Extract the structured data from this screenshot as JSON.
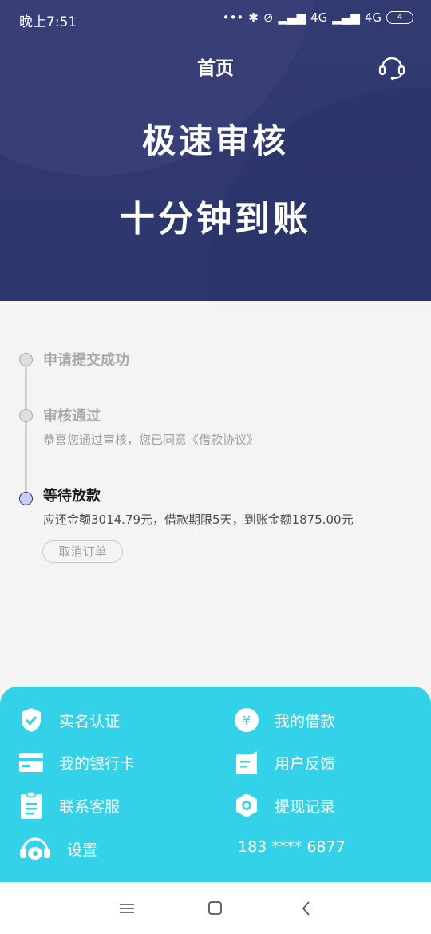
{
  "status_bar": {
    "time": "晚上7:51",
    "dots": "•••",
    "net1": "4G",
    "net2": "4G",
    "battery": "4"
  },
  "header": {
    "title": "首页",
    "service_icon": "headset-icon"
  },
  "banner": {
    "line1": "极速审核",
    "line2": "十分钟到账"
  },
  "timeline": {
    "steps": [
      {
        "title": "申请提交成功",
        "desc": ""
      },
      {
        "title": "审核通过",
        "desc": "恭喜您通过审核，您已同意《借款协议》"
      },
      {
        "title": "等待放款",
        "desc": "应还金额3014.79元，借款期限5天，到账金额1875.00元"
      }
    ],
    "cancel_label": "取消订单"
  },
  "menu": {
    "real_name": "实名认证",
    "my_loan": "我的借款",
    "bank_card": "我的银行卡",
    "feedback": "用户反馈",
    "contact": "联系客服",
    "withdraw": "提现记录",
    "settings": "设置",
    "phone": "183 **** 6877"
  },
  "colors": {
    "hero": "#2e376d",
    "panel": "#33d2e9",
    "active_dot": "#c7d0f4"
  }
}
